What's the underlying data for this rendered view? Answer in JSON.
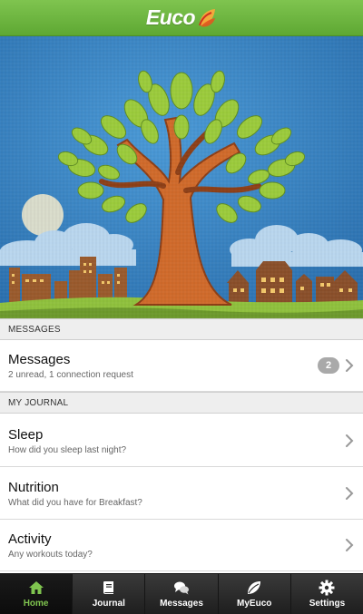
{
  "header": {
    "logo_text": "Euco"
  },
  "sections": {
    "messages": {
      "title": "MESSAGES"
    },
    "journal": {
      "title": "MY JOURNAL"
    }
  },
  "messages_item": {
    "title": "Messages",
    "subtitle": "2 unread, 1 connection request",
    "badge": "2"
  },
  "journal_items": [
    {
      "title": "Sleep",
      "subtitle": "How did you sleep last night?"
    },
    {
      "title": "Nutrition",
      "subtitle": "What did you have for Breakfast?"
    },
    {
      "title": "Activity",
      "subtitle": "Any workouts today?"
    }
  ],
  "tabs": [
    {
      "label": "Home",
      "icon": "home-icon",
      "active": true
    },
    {
      "label": "Journal",
      "icon": "book-icon",
      "active": false
    },
    {
      "label": "Messages",
      "icon": "chat-bubbles-icon",
      "active": false
    },
    {
      "label": "MyEuco",
      "icon": "leaf-icon",
      "active": false
    },
    {
      "label": "Settings",
      "icon": "gear-icon",
      "active": false
    }
  ],
  "colors": {
    "brand_green": "#6fb641",
    "sky_blue": "#3a86c8",
    "tab_active": "#7fc44f",
    "badge_gray": "#a9a9a9"
  }
}
